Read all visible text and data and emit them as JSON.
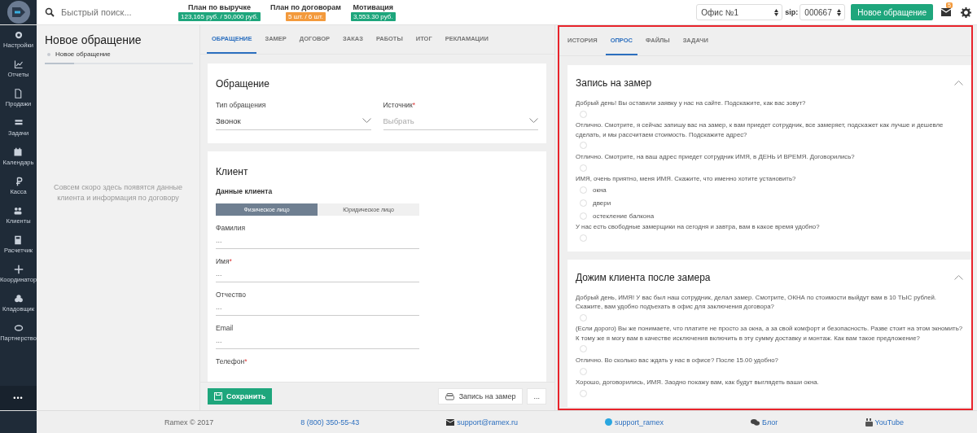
{
  "search": {
    "placeholder": "Быстрый поиск..."
  },
  "metrics": [
    {
      "label": "План по выручке",
      "value": "123,165 руб. / 50,000 руб.",
      "color": "#1ea67c"
    },
    {
      "label": "План по договорам",
      "value": "5 шт. / 6 шт.",
      "color": "#f39a3c"
    },
    {
      "label": "Мотивация",
      "value": "3,553.30 руб.",
      "color": "#1ea67c"
    }
  ],
  "office_select": {
    "value": "Офис №1"
  },
  "sip": {
    "label": "sip:",
    "value": "000667"
  },
  "new_request_button": "Новое обращение",
  "mail": {
    "badge": "5"
  },
  "sidebar": {
    "items": [
      {
        "label": "Настройки"
      },
      {
        "label": "Отчеты"
      },
      {
        "label": "Продажи"
      },
      {
        "label": "Задачи"
      },
      {
        "label": "Календарь"
      },
      {
        "label": "Касса"
      },
      {
        "label": "Клиенты"
      },
      {
        "label": "Расчетчик"
      },
      {
        "label": "Координатор"
      },
      {
        "label": "Кладовщик"
      },
      {
        "label": "Партнерство"
      }
    ],
    "more": "•••"
  },
  "left_panel": {
    "title": "Новое обращение",
    "breadcrumb": "Новое обращение",
    "progress": {
      "level": 0.2
    },
    "empty_message": "Совсем скоро здесь появятся данные клиента и информация по договору"
  },
  "middle_tabs": [
    {
      "label": "ОБРАЩЕНИЕ",
      "selected": true
    },
    {
      "label": "ЗАМЕР",
      "selected": false
    },
    {
      "label": "ДОГОВОР",
      "selected": false
    },
    {
      "label": "ЗАКАЗ",
      "selected": false
    },
    {
      "label": "РАБОТЫ",
      "selected": false
    },
    {
      "label": "ИТОГ",
      "selected": false
    },
    {
      "label": "РЕКЛАМАЦИИ",
      "selected": false
    }
  ],
  "request_card": {
    "title": "Обращение",
    "selects": [
      {
        "label": "Тип обращения",
        "value": "Звонок"
      },
      {
        "label": "Источник",
        "required_mark": "*",
        "placeholder": "Выбрать"
      }
    ]
  },
  "client_card": {
    "title": "Клиент",
    "subtitle": "Данные клиента",
    "person_types": [
      {
        "label": "Физическое лицо",
        "selected": true
      },
      {
        "label": "Юридическое лицо",
        "selected": false
      }
    ],
    "fields": [
      {
        "label": "Фамилия",
        "placeholder": "..."
      },
      {
        "label": "Имя",
        "required_mark": "*",
        "placeholder": "..."
      },
      {
        "label": "Отчество",
        "placeholder": "..."
      },
      {
        "label": "Email",
        "placeholder": "..."
      },
      {
        "label": "Телефон",
        "required_mark": "*"
      }
    ]
  },
  "actions": {
    "save": "Сохранить",
    "measure": "Запись на замер",
    "more": "..."
  },
  "right_tabs": [
    {
      "label": "ИСТОРИЯ",
      "selected": false
    },
    {
      "label": "ОПРОС",
      "selected": true
    },
    {
      "label": "ФАЙЛЫ",
      "selected": false
    },
    {
      "label": "ЗАДАЧИ",
      "selected": false
    }
  ],
  "sections": [
    {
      "title": "Запись на замер",
      "expanded": true,
      "questions": [
        {
          "text": "Добрый день! Вы оставили заявку у нас на сайте. Подскажите, как вас зовут?",
          "options": [
            {
              "selected": false
            }
          ]
        },
        {
          "text": "Отлично. Смотрите, я сейчас запишу вас на замер, к вам приедет сотрудник, все замеряет, подскажет как лучше и дешевле сделать, и мы рассчитаем стоимость. Подскажите адрес?",
          "options": [
            {
              "selected": false
            }
          ]
        },
        {
          "text": "Отлично. Смотрите, на ваш адрес приедет сотрудник ИМЯ, в ДЕНЬ И ВРЕМЯ. Договорились?",
          "options": [
            {
              "selected": false
            }
          ]
        },
        {
          "text": "ИМЯ, очень приятно, меня ИМЯ. Скажите, что именно хотите установить?",
          "options": [
            {
              "label": "окна",
              "selected": false
            },
            {
              "label": "двери",
              "selected": false
            },
            {
              "label": "остекление балкона",
              "selected": false
            }
          ]
        },
        {
          "text": "У нас есть свободные замерщики на сегодня и завтра, вам в какое время удобно?",
          "options": [
            {
              "selected": false
            }
          ]
        }
      ]
    },
    {
      "title": "Дожим клиента после замера",
      "expanded": true,
      "questions": [
        {
          "text": "Добрый день, ИМЯ! У вас был наш сотрудник, делал замер. Смотрите, ОКНА по стоимости выйдут вам в 10 ТЫС рублей. Скажите, вам удобно подъехать в офис для заключения договора?",
          "options": [
            {
              "selected": false
            }
          ]
        },
        {
          "text": "(Если дорого) Вы же понимаете, что платите не просто за окна, а за свой комфорт и безопасность. Разве стоит на этом экномить? К тому же я могу вам в качестве исключения включить в эту сумму доставку и монтаж. Как вам такое предложение?",
          "options": [
            {
              "selected": false
            }
          ]
        },
        {
          "text": "Отлично. Во сколько вас ждать у нас в офисе? После 15.00 удобно?",
          "options": [
            {
              "selected": false
            }
          ]
        },
        {
          "text": "Хорошо, договорились, ИМЯ. Заодно покажу вам, как будут выглядеть ваши окна.",
          "options": [
            {
              "selected": false
            }
          ]
        }
      ]
    }
  ],
  "footer": {
    "copyright": "Ramex © 2017",
    "links": [
      {
        "kind": "phone",
        "label": "8 (800) 350-55-43"
      },
      {
        "kind": "email",
        "label": "support@ramex.ru"
      },
      {
        "kind": "skype",
        "label": "support_ramex"
      },
      {
        "kind": "blog",
        "label": "Блог"
      },
      {
        "kind": "youtube",
        "label": "YouTube"
      }
    ]
  }
}
